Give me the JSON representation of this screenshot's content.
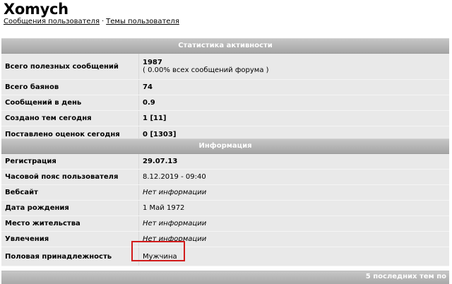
{
  "user": {
    "name": "Xomych"
  },
  "links": {
    "posts": "Сообщения пользователя",
    "separator": "·",
    "topics": "Темы пользователя"
  },
  "stats": {
    "header": "Статистика активности",
    "total_posts_label": "Всего полезных сообщений",
    "total_posts_value": "1987",
    "total_posts_sub": "( 0.00% всех сообщений форума )",
    "bans_label": "Всего баянов",
    "bans_value": "74",
    "per_day_label": "Сообщений в день",
    "per_day_value": "0.9",
    "topics_today_label": "Создано тем сегодня",
    "topics_today_value": "1 [11]",
    "ratings_today_label": "Поставлено оценок сегодня",
    "ratings_today_value": "0 [1303]"
  },
  "info": {
    "header": "Информация",
    "registration_label": "Регистрация",
    "registration_value": "29.07.13",
    "timezone_label": "Часовой пояс пользователя",
    "timezone_value": "8.12.2019 - 09:40",
    "website_label": "Вебсайт",
    "website_value": "Нет информации",
    "birthday_label": "Дата рождения",
    "birthday_value": "1 Май 1972",
    "location_label": "Место жительства",
    "location_value": "Нет информации",
    "hobbies_label": "Увлечения",
    "hobbies_value": "Нет информации",
    "gender_label": "Половая принадлежность",
    "gender_value": "Мужчина"
  },
  "footer": {
    "recent_topics": "5 последних тем по"
  },
  "colors": {
    "header_bar": "#b5b5b5",
    "row_bg": "#e9e9e9",
    "highlight": "#d21b1b"
  }
}
